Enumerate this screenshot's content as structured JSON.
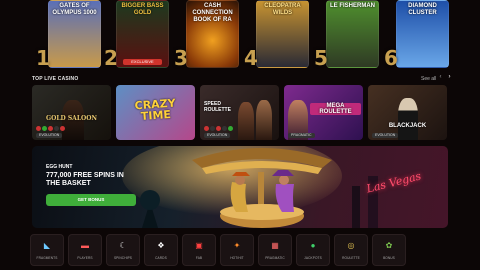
{
  "top_games": {
    "cards": [
      {
        "title": "GATES OF OLYMPUS 1000",
        "rank": "1",
        "color_top": "#5a6fb8",
        "color_bottom": "#c89a4a"
      },
      {
        "title": "BIGGER BASS GOLD",
        "rank": "2",
        "badge": "EXCLUSIVE",
        "color_top": "#1d3a1f",
        "color_bottom": "#5a1010"
      },
      {
        "title": "CASH CONNECTION BOOK OF RA",
        "rank": "3",
        "color_top": "#3b1e0c",
        "color_bottom": "#c9610e"
      },
      {
        "title": "CLEOPATRA WILDS",
        "rank": "4",
        "color_top": "#c79331",
        "color_bottom": "#2a2a35"
      },
      {
        "title": "LE FISHERMAN",
        "rank": "5",
        "color_top": "#4f8f2e",
        "color_bottom": "#2f3a24"
      },
      {
        "title": "DIAMOND CLUSTER",
        "rank": "6",
        "color_top": "#1e4fa8",
        "color_bottom": "#6aa7e8"
      }
    ]
  },
  "live_casino": {
    "title": "TOP LIVE CASINO",
    "see_all": "See all",
    "prev_arrow": "‹",
    "next_arrow": "›",
    "cards": [
      {
        "name": "GOLD SALOON",
        "tag": "EVOLUTION",
        "color_a": "#2b2a25",
        "color_b": "#15110c"
      },
      {
        "name": "CRAZY TIME",
        "tag": "EVOLUTION",
        "color_a": "#5d8fc4",
        "color_b": "#b5478a"
      },
      {
        "name": "SPEED ROULETTE",
        "tag": "EVOLUTION",
        "color_a": "#3a2b2a",
        "color_b": "#19110f"
      },
      {
        "name": "MEGA ROULETTE",
        "tag": "PRAGMATIC",
        "color_a": "#7e2a8e",
        "color_b": "#2e1150"
      },
      {
        "name": "BLACKJACK",
        "tag": "EVOLUTION",
        "color_a": "#463022",
        "color_b": "#1c1310"
      }
    ]
  },
  "promo": {
    "eyebrow": "EGG HUNT",
    "headline": "777,000 FREE SPINS IN THE BASKET",
    "cta": "GET BONUS",
    "neon_sign": "Las Vegas"
  },
  "categories": [
    {
      "label": "FRAGMENTS",
      "icon": "feather-icon",
      "glyph": "◣",
      "color": "#6cc8ff"
    },
    {
      "label": "PLAYERS",
      "icon": "card-icon",
      "glyph": "▬",
      "color": "#ff5a5a"
    },
    {
      "label": "SPINCHIPS",
      "icon": "moon-icon",
      "glyph": "☾",
      "color": "#e8e8e8"
    },
    {
      "label": "CARDS",
      "icon": "cards-icon",
      "glyph": "❖",
      "color": "#ffffff"
    },
    {
      "label": "FAB",
      "icon": "slot-icon",
      "glyph": "▣",
      "color": "#ff4040"
    },
    {
      "label": "HOT/HIT",
      "icon": "fire-icon",
      "glyph": "✦",
      "color": "#ff8c2a"
    },
    {
      "label": "PRAGMATIC",
      "icon": "grid-icon",
      "glyph": "▦",
      "color": "#ff6b6b"
    },
    {
      "label": "JACKPOTS",
      "icon": "coin-icon",
      "glyph": "●",
      "color": "#3fcf6a"
    },
    {
      "label": "ROULETTE",
      "icon": "wheel-icon",
      "glyph": "◎",
      "color": "#e0c050"
    },
    {
      "label": "BONUS",
      "icon": "gift-icon",
      "glyph": "✿",
      "color": "#7ec850"
    }
  ]
}
